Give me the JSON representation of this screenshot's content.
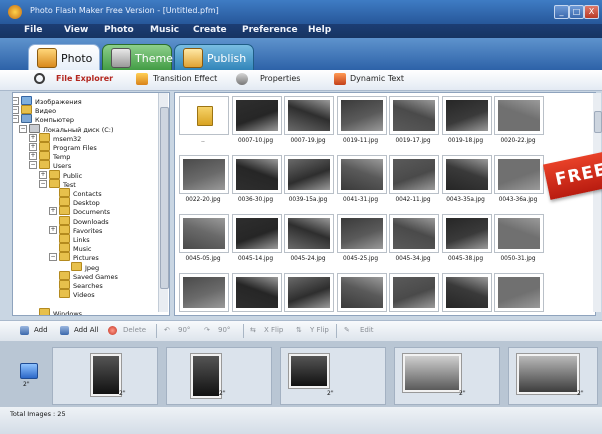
{
  "window": {
    "title": "Photo Flash Maker Free Version - [Untitled.pfm]",
    "controls": [
      "_",
      "□",
      "X"
    ]
  },
  "menu": [
    "File",
    "View",
    "Photo",
    "Music",
    "Create",
    "Preference",
    "Help"
  ],
  "tabs": [
    {
      "label": "Photo",
      "icon": "photo-tab-icon"
    },
    {
      "label": "Theme",
      "icon": "theme-tab-icon"
    },
    {
      "label": "Publish",
      "icon": "publish-tab-icon"
    }
  ],
  "subtoolbar": [
    {
      "label": "File Explorer",
      "icon": "magnifier-icon"
    },
    {
      "label": "Transition Effect",
      "icon": "transition-icon"
    },
    {
      "label": "Properties",
      "icon": "properties-icon"
    },
    {
      "label": "Dynamic Text",
      "icon": "dynamic-text-icon"
    }
  ],
  "tree": [
    {
      "label": "Изображения",
      "type": "img"
    },
    {
      "label": "Видео",
      "type": "fold"
    },
    {
      "label": "Компьютер",
      "type": "pc"
    },
    {
      "label": "Локальный диск (C:)",
      "type": "drv"
    },
    {
      "label": "msem32",
      "type": "fold"
    },
    {
      "label": "Program Files",
      "type": "fold"
    },
    {
      "label": "Temp",
      "type": "fold"
    },
    {
      "label": "Users",
      "type": "fold"
    },
    {
      "label": "Public",
      "type": "fold"
    },
    {
      "label": "Test",
      "type": "fold"
    },
    {
      "label": "Contacts",
      "type": "fold"
    },
    {
      "label": "Desktop",
      "type": "fold"
    },
    {
      "label": "Documents",
      "type": "fold"
    },
    {
      "label": "Downloads",
      "type": "fold"
    },
    {
      "label": "Favorites",
      "type": "fold"
    },
    {
      "label": "Links",
      "type": "fold"
    },
    {
      "label": "Music",
      "type": "fold"
    },
    {
      "label": "Pictures",
      "type": "fold"
    },
    {
      "label": "Jpeg",
      "type": "fold"
    },
    {
      "label": "Saved Games",
      "type": "fold"
    },
    {
      "label": "Searches",
      "type": "fold"
    },
    {
      "label": "Videos",
      "type": "fold"
    },
    {
      "label": "Windows",
      "type": "fold"
    }
  ],
  "thumbnails": [
    "..",
    "0007-10.jpg",
    "0007-19.jpg",
    "0019-11.jpg",
    "0019-17.jpg",
    "0019-18.jpg",
    "0020-22.jpg",
    "0022-20.jpg",
    "0036-30.jpg",
    "0039-15a.jpg",
    "0041-31.jpg",
    "0042-11.jpg",
    "0043-35a.jpg",
    "0043-36a.jpg",
    "0045-05.jpg",
    "0045-14.jpg",
    "0045-24.jpg",
    "0045-25.jpg",
    "0045-34.jpg",
    "0045-38.jpg",
    "0050-31.jpg",
    "",
    "",
    "",
    "",
    "",
    "",
    ""
  ],
  "banner": "FREE",
  "bottom_toolbar": {
    "add": "Add",
    "add_all": "Add All",
    "delete": "Delete",
    "rotate_left": "90°",
    "rotate_right": "90°",
    "xflip": "X Flip",
    "yflip": "Y Flip",
    "edit": "Edit"
  },
  "timeline": {
    "transition_label": "2\"",
    "slide_label": "2\""
  },
  "status": "Total Images : 25"
}
